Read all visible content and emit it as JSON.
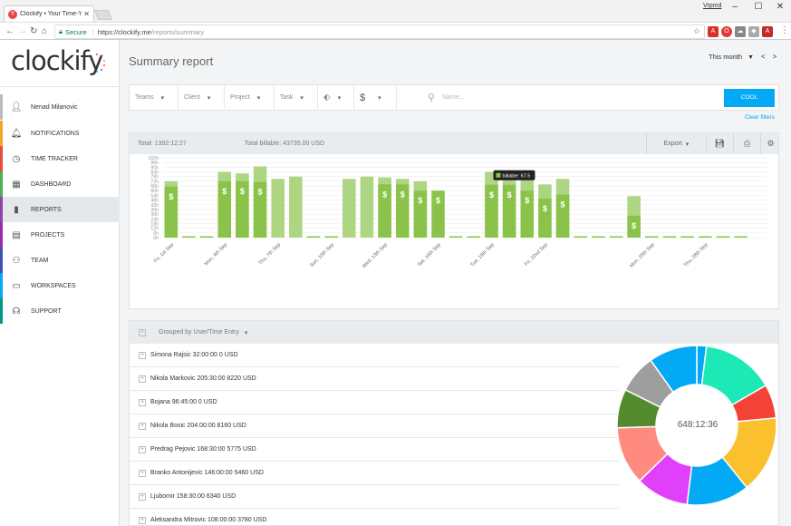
{
  "browser": {
    "tab_title": "Clockify • Your Time-You",
    "tab_favicon": "Y",
    "user": "Vrpmd",
    "secure_label": "Secure",
    "url_prefix": "https://clockify.me",
    "url_path": "/reports/summary"
  },
  "sidebar": {
    "logo_text": "clockify",
    "items": [
      {
        "label": "Nenad Milanovic",
        "icon": "user-avatar-icon",
        "color": "#bbbbbb"
      },
      {
        "label": "NOTIFICATIONS",
        "icon": "bell-icon",
        "color": "#f5a623"
      },
      {
        "label": "TIME TRACKER",
        "icon": "clock-icon",
        "color": "#e74c3c"
      },
      {
        "label": "DASHBOARD",
        "icon": "dashboard-icon",
        "color": "#4caf50"
      },
      {
        "label": "REPORTS",
        "icon": "bar-chart-icon",
        "color": "#8e44ad"
      },
      {
        "label": "PROJECTS",
        "icon": "document-icon",
        "color": "#9c27b0"
      },
      {
        "label": "TEAM",
        "icon": "team-icon",
        "color": "#3f51b5"
      },
      {
        "label": "WORKSPACES",
        "icon": "monitor-icon",
        "color": "#03a9f4"
      },
      {
        "label": "SUPPORT",
        "icon": "headset-icon",
        "color": "#009688"
      }
    ]
  },
  "header": {
    "title": "Summary report",
    "period": "This month",
    "prev": "<",
    "next": ">"
  },
  "filters": {
    "teams": "Teams",
    "client": "Client",
    "project": "Project",
    "task": "Task",
    "currency": "$",
    "search_placeholder": "Name...",
    "apply_label": "COOL",
    "clear_label": "Clear filters"
  },
  "summary": {
    "total_label": "Total:",
    "total_value": "1392:12:27",
    "billable_label": "Total billable:",
    "billable_value": "43735.00 USD",
    "export_label": "Export"
  },
  "chart_data": {
    "type": "bar",
    "yticks": [
      "0h",
      "6h",
      "12h",
      "18h",
      "24h",
      "30h",
      "36h",
      "42h",
      "48h",
      "54h",
      "60h",
      "66h",
      "72h",
      "78h",
      "84h",
      "90h",
      "96h",
      "102h"
    ],
    "ylim": [
      0,
      102
    ],
    "bar_color_billable": "#8bc34a",
    "bar_color_total": "#aed581",
    "tooltip": "billable: 67.5",
    "tooltip_index": 18,
    "categories": [
      "Fri, 1st Sep",
      "",
      "",
      "Mon, 4th Sep",
      "",
      "",
      "Thu, 7th Sep",
      "",
      "",
      "Sun, 10th Sep",
      "",
      "",
      "Wed, 13th Sep",
      "",
      "",
      "Sat, 16th Sep",
      "",
      "",
      "Tue, 19th Sep",
      "",
      "",
      "Fri, 22nd Sep",
      "",
      "",
      "",
      "",
      "",
      "Mon, 25th Sep",
      "",
      "",
      "Thu, 28th Sep",
      "",
      "",
      ""
    ],
    "series": [
      {
        "name": "billable",
        "values": [
          65,
          0,
          0,
          72,
          72,
          71,
          0,
          0,
          0,
          0,
          0,
          0,
          68,
          68,
          60,
          60,
          0,
          0,
          67.5,
          67.5,
          60,
          50,
          55,
          0,
          0,
          0,
          28,
          0,
          0,
          0,
          0,
          0,
          0
        ]
      },
      {
        "name": "total",
        "values": [
          72,
          0,
          0,
          84,
          82,
          91,
          75,
          78,
          0,
          0,
          75,
          78,
          77,
          75,
          72,
          0,
          0,
          0,
          84,
          84,
          78,
          68,
          75,
          0,
          0,
          0,
          53,
          0,
          0,
          0,
          0,
          0,
          0
        ]
      }
    ]
  },
  "grouping": {
    "label": "Grouped by User/Time Entry"
  },
  "rows": [
    "Simona Rajsic 32:00:00 0 USD",
    "Nikola Markovic 205:30:00 8220 USD",
    "Bojana 96:45:00 0 USD",
    "Nikola Bosic 204:00:00 8160 USD",
    "Predrag Pejovic 168:30:00 5775 USD",
    "Branko Antonijevic 146:00:00 5460 USD",
    "Ljubomir 158:30:00 6340 USD",
    "Aleksandra Mitrovic 108:00:00 3780 USD"
  ],
  "donut": {
    "center_label": "648:12:36",
    "slices": [
      {
        "value": 2,
        "color": "#03a9f4"
      },
      {
        "value": 15,
        "color": "#1de9b6"
      },
      {
        "value": 7,
        "color": "#f44336"
      },
      {
        "value": 16,
        "color": "#fbc02d"
      },
      {
        "value": 13,
        "color": "#03a9f4"
      },
      {
        "value": 11,
        "color": "#e040fb"
      },
      {
        "value": 12,
        "color": "#ff8a80"
      },
      {
        "value": 8,
        "color": "#558b2f"
      },
      {
        "value": 8,
        "color": "#9e9e9e"
      },
      {
        "value": 10,
        "color": "#03a9f4"
      }
    ]
  }
}
